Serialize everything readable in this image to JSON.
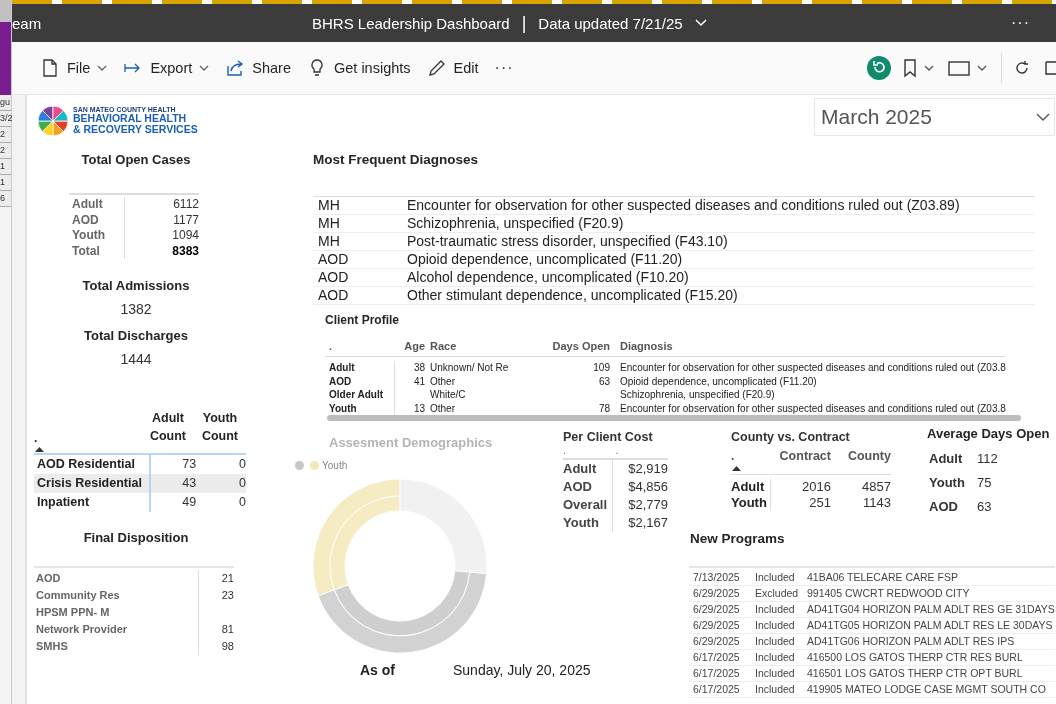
{
  "side_window": {
    "items": [
      "gu",
      "3/2",
      "2",
      "2",
      "1",
      "1",
      "6"
    ]
  },
  "title_bar": {
    "app_name": "eam",
    "report_title": "BHRS Leadership Dashboard",
    "separator": "|",
    "data_updated": "Data updated 7/21/25",
    "more": "···"
  },
  "toolbar": {
    "items": [
      {
        "kind": "file",
        "label": "File",
        "dropdown": true
      },
      {
        "kind": "export",
        "label": "Export",
        "dropdown": true
      },
      {
        "kind": "share",
        "label": "Share",
        "dropdown": false
      },
      {
        "kind": "insights",
        "label": "Get insights",
        "dropdown": false
      },
      {
        "kind": "edit",
        "label": "Edit",
        "dropdown": false
      }
    ],
    "more": "···"
  },
  "logo": {
    "small": "SAN MATEO COUNTY HEALTH",
    "line1": "BEHAVIORAL HEALTH",
    "line2": "& RECOVERY SERVICES"
  },
  "month_slicer": {
    "value": "March 2025"
  },
  "open_cases": {
    "title": "Total Open Cases",
    "rows": [
      {
        "label": "Adult",
        "value": "6112",
        "total": false
      },
      {
        "label": "AOD",
        "value": "1177",
        "total": false
      },
      {
        "label": "Youth",
        "value": "1094",
        "total": false
      },
      {
        "label": "Total",
        "value": "8383",
        "total": true
      }
    ]
  },
  "total_admissions": {
    "title": "Total Admissions",
    "value": "1382"
  },
  "total_discharges": {
    "title": "Total Discharges",
    "value": "1444"
  },
  "residential": {
    "columns": [
      ".",
      "Adult Count",
      "Youth Count"
    ],
    "rows": [
      {
        "label": "AOD Residential",
        "adult": "73",
        "youth": "0",
        "selected": false
      },
      {
        "label": "Crisis Residential",
        "adult": "43",
        "youth": "0",
        "selected": true
      },
      {
        "label": "Inpatient",
        "adult": "49",
        "youth": "0",
        "selected": false
      }
    ]
  },
  "final_disposition": {
    "title": "Final Disposition",
    "rows": [
      {
        "label": "AOD",
        "value": "21"
      },
      {
        "label": "Community Res",
        "value": "23"
      },
      {
        "label": "HPSM PPN- M"
      },
      {
        "label": "Network Provider",
        "value": "81"
      },
      {
        "label": "SMHS",
        "value": "98"
      }
    ]
  },
  "diagnoses": {
    "title": "Most Frequent Diagnoses",
    "rows": [
      {
        "category": "MH",
        "description": "Encounter for observation for other suspected diseases and conditions ruled out (Z03.89)"
      },
      {
        "category": "MH",
        "description": "Schizophrenia, unspecified (F20.9)"
      },
      {
        "category": "MH",
        "description": "Post-traumatic stress disorder, unspecified (F43.10)"
      },
      {
        "category": "AOD",
        "description": "Opioid dependence, uncomplicated (F11.20)"
      },
      {
        "category": "AOD",
        "description": "Alcohol dependence, uncomplicated (F10.20)"
      },
      {
        "category": "AOD",
        "description": "Other stimulant dependence, uncomplicated (F15.20)"
      }
    ]
  },
  "client_profile": {
    "title": "Client Profile",
    "columns": [
      ".",
      "Age",
      "Race",
      "Days Open",
      "Diagnosis"
    ],
    "rows": [
      {
        "group": "Adult",
        "age": "38",
        "race": "Unknown/ Not Re",
        "days_open": "109",
        "diagnosis": "Encounter for observation for other suspected diseases and conditions ruled out (Z03.8"
      },
      {
        "group": "AOD",
        "age": "41",
        "race": "Other",
        "days_open": "63",
        "diagnosis": "Opioid dependence, uncomplicated (F11.20)"
      },
      {
        "group": "Older Adult",
        "race": "White/C",
        "diagnosis": "Schizophrenia, unspecified (F20.9)"
      },
      {
        "group": "Youth",
        "age": "13",
        "race": "Other",
        "days_open": "78",
        "diagnosis": "Encounter for observation for other suspected diseases and conditions ruled out (Z03.8"
      }
    ]
  },
  "demographics": {
    "title": "Assesment Demographics",
    "legend": [
      {
        "color": "#c8c8c8"
      },
      {
        "label": "Youth",
        "color": "#f3e9b8"
      }
    ]
  },
  "as_of": {
    "label": "As of",
    "date": "Sunday, July 20, 2025"
  },
  "per_client_cost": {
    "title": "Per Client Cost",
    "columns": [
      ".",
      "."
    ],
    "rows": [
      {
        "label": "Adult",
        "value": "$2,919"
      },
      {
        "label": "AOD",
        "value": "$4,856"
      },
      {
        "label": "Overall",
        "value": "$2,779"
      },
      {
        "label": "Youth",
        "value": "$2,167"
      }
    ]
  },
  "county_contract": {
    "title": "County vs. Contract",
    "columns": [
      ".",
      "Contract",
      "County"
    ],
    "rows": [
      {
        "label": "Adult",
        "contract": "2016",
        "county": "4857"
      },
      {
        "label": "Youth",
        "contract": "251",
        "county": "1143"
      }
    ]
  },
  "average_days_open": {
    "title": "Average Days Open",
    "rows": [
      {
        "label": "Adult",
        "value": "112"
      },
      {
        "label": "Youth",
        "value": "75"
      },
      {
        "label": "AOD",
        "value": "63"
      }
    ]
  },
  "new_programs": {
    "title": "New Programs",
    "rows": [
      {
        "date": "7/13/2025",
        "status": "Included",
        "program": "41BA06 TELECARE CARE FSP"
      },
      {
        "date": "6/29/2025",
        "status": "Excluded",
        "program": "991405 CWCRT REDWOOD CITY"
      },
      {
        "date": "6/29/2025",
        "status": "Included",
        "program": "AD41TG04 HORIZON PALM ADLT RES GE 31DAYS"
      },
      {
        "date": "6/29/2025",
        "status": "Included",
        "program": "AD41TG05 HORIZON PALM ADLT RES LE 30DAYS"
      },
      {
        "date": "6/29/2025",
        "status": "Included",
        "program": "AD41TG06 HORIZON PALM ADLT RES IPS"
      },
      {
        "date": "6/17/2025",
        "status": "Included",
        "program": "416500 LOS GATOS THERP CTR RES BURL"
      },
      {
        "date": "6/17/2025",
        "status": "Included",
        "program": "416501 LOS GATOS THERP CTR OPT BURL"
      },
      {
        "date": "6/17/2025",
        "status": "Included",
        "program": "419905 MATEO LODGE CASE MGMT SOUTH CO"
      }
    ]
  }
}
